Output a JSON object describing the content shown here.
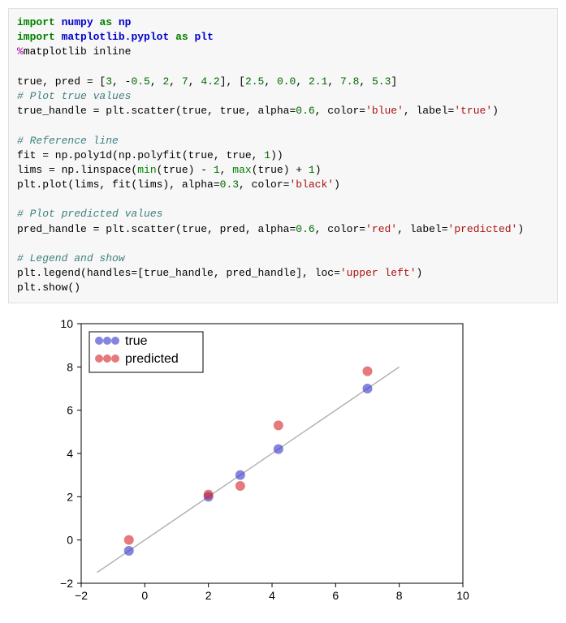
{
  "code": {
    "line1a": "import",
    "line1b": "numpy",
    "line1c": "as",
    "line1d": "np",
    "line2a": "import",
    "line2b": "matplotlib.pyplot",
    "line2c": "as",
    "line2d": "plt",
    "line3a": "%",
    "line3b": "matplotlib inline",
    "blank": "",
    "line4_pre": "true, pred = [",
    "n1": "3",
    "c": ", ",
    "neg": "-",
    "n2": "0.5",
    "n3": "2",
    "n4": "7",
    "n5": "4.2",
    "mid": "], [",
    "n6": "2.5",
    "n7": "0.0",
    "n8": "2.1",
    "n9": "7.8",
    "n10": "5.3",
    "end4": "]",
    "cmt1": "# Plot true values",
    "l6a": "true_handle = plt.scatter(true, true, alpha=",
    "p06": "0.6",
    "l6b": ", color=",
    "blue": "'blue'",
    "l6c": ", label=",
    "truestr": "'true'",
    "close": ")",
    "cmt2": "# Reference line",
    "l8": "fit = np.poly1d(np.polyfit(true, true, ",
    "one": "1",
    "l8b": "))",
    "l9a": "lims = np.linspace(",
    "minf": "min",
    "l9b": "(true) - ",
    "l9c": ", ",
    "maxf": "max",
    "l9d": "(true) + ",
    "l10a": "plt.plot(lims, fit(lims), alpha=",
    "p03": "0.3",
    "l10b": ", color=",
    "black": "'black'",
    "cmt3": "# Plot predicted values",
    "l12a": "pred_handle = plt.scatter(true, pred, alpha=",
    "l12b": ", color=",
    "red": "'red'",
    "l12c": ", label=",
    "predstr": "'predicted'",
    "cmt4": "# Legend and show",
    "l14a": "plt.legend(handles=[true_handle, pred_handle], loc=",
    "upleft": "'upper left'",
    "l15": "plt.show()"
  },
  "chart_data": {
    "type": "scatter",
    "title": "",
    "xlabel": "",
    "ylabel": "",
    "xlim": [
      -2,
      10
    ],
    "ylim": [
      -2,
      10
    ],
    "xticks": [
      -2,
      0,
      2,
      4,
      6,
      8,
      10
    ],
    "yticks": [
      -2,
      0,
      2,
      4,
      6,
      8,
      10
    ],
    "series": [
      {
        "name": "true",
        "color": "#3333cc",
        "alpha": 0.6,
        "x": [
          3,
          -0.5,
          2,
          7,
          4.2
        ],
        "y": [
          3,
          -0.5,
          2,
          7,
          4.2
        ]
      },
      {
        "name": "predicted",
        "color": "#d62222",
        "alpha": 0.6,
        "x": [
          3,
          -0.5,
          2,
          7,
          4.2
        ],
        "y": [
          2.5,
          0.0,
          2.1,
          7.8,
          5.3
        ]
      }
    ],
    "reference_line": {
      "x": [
        -1.5,
        8
      ],
      "y": [
        -1.5,
        8
      ],
      "color": "#000000",
      "alpha": 0.3
    },
    "legend": {
      "position": "upper left",
      "entries": [
        "true",
        "predicted"
      ]
    }
  }
}
